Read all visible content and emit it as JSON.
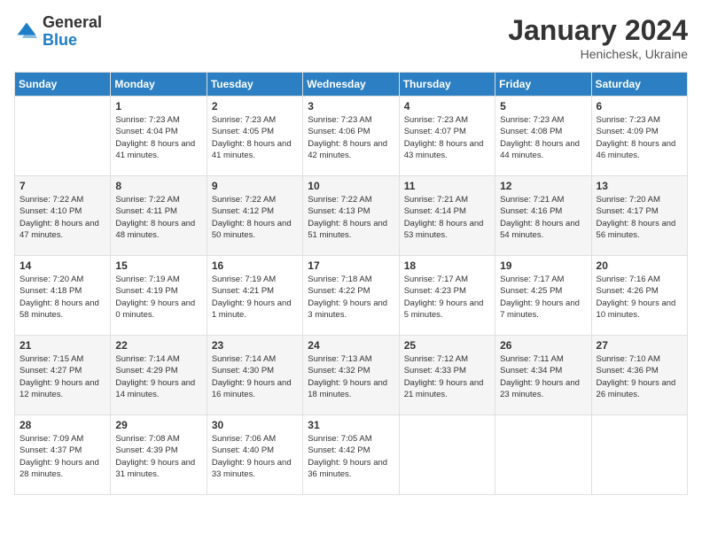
{
  "header": {
    "logo_general": "General",
    "logo_blue": "Blue",
    "month_year": "January 2024",
    "location": "Henichesk, Ukraine"
  },
  "days_of_week": [
    "Sunday",
    "Monday",
    "Tuesday",
    "Wednesday",
    "Thursday",
    "Friday",
    "Saturday"
  ],
  "weeks": [
    [
      {
        "day": "",
        "sunrise": "",
        "sunset": "",
        "daylight": ""
      },
      {
        "day": "1",
        "sunrise": "Sunrise: 7:23 AM",
        "sunset": "Sunset: 4:04 PM",
        "daylight": "Daylight: 8 hours and 41 minutes."
      },
      {
        "day": "2",
        "sunrise": "Sunrise: 7:23 AM",
        "sunset": "Sunset: 4:05 PM",
        "daylight": "Daylight: 8 hours and 41 minutes."
      },
      {
        "day": "3",
        "sunrise": "Sunrise: 7:23 AM",
        "sunset": "Sunset: 4:06 PM",
        "daylight": "Daylight: 8 hours and 42 minutes."
      },
      {
        "day": "4",
        "sunrise": "Sunrise: 7:23 AM",
        "sunset": "Sunset: 4:07 PM",
        "daylight": "Daylight: 8 hours and 43 minutes."
      },
      {
        "day": "5",
        "sunrise": "Sunrise: 7:23 AM",
        "sunset": "Sunset: 4:08 PM",
        "daylight": "Daylight: 8 hours and 44 minutes."
      },
      {
        "day": "6",
        "sunrise": "Sunrise: 7:23 AM",
        "sunset": "Sunset: 4:09 PM",
        "daylight": "Daylight: 8 hours and 46 minutes."
      }
    ],
    [
      {
        "day": "7",
        "sunrise": "Sunrise: 7:22 AM",
        "sunset": "Sunset: 4:10 PM",
        "daylight": "Daylight: 8 hours and 47 minutes."
      },
      {
        "day": "8",
        "sunrise": "Sunrise: 7:22 AM",
        "sunset": "Sunset: 4:11 PM",
        "daylight": "Daylight: 8 hours and 48 minutes."
      },
      {
        "day": "9",
        "sunrise": "Sunrise: 7:22 AM",
        "sunset": "Sunset: 4:12 PM",
        "daylight": "Daylight: 8 hours and 50 minutes."
      },
      {
        "day": "10",
        "sunrise": "Sunrise: 7:22 AM",
        "sunset": "Sunset: 4:13 PM",
        "daylight": "Daylight: 8 hours and 51 minutes."
      },
      {
        "day": "11",
        "sunrise": "Sunrise: 7:21 AM",
        "sunset": "Sunset: 4:14 PM",
        "daylight": "Daylight: 8 hours and 53 minutes."
      },
      {
        "day": "12",
        "sunrise": "Sunrise: 7:21 AM",
        "sunset": "Sunset: 4:16 PM",
        "daylight": "Daylight: 8 hours and 54 minutes."
      },
      {
        "day": "13",
        "sunrise": "Sunrise: 7:20 AM",
        "sunset": "Sunset: 4:17 PM",
        "daylight": "Daylight: 8 hours and 56 minutes."
      }
    ],
    [
      {
        "day": "14",
        "sunrise": "Sunrise: 7:20 AM",
        "sunset": "Sunset: 4:18 PM",
        "daylight": "Daylight: 8 hours and 58 minutes."
      },
      {
        "day": "15",
        "sunrise": "Sunrise: 7:19 AM",
        "sunset": "Sunset: 4:19 PM",
        "daylight": "Daylight: 9 hours and 0 minutes."
      },
      {
        "day": "16",
        "sunrise": "Sunrise: 7:19 AM",
        "sunset": "Sunset: 4:21 PM",
        "daylight": "Daylight: 9 hours and 1 minute."
      },
      {
        "day": "17",
        "sunrise": "Sunrise: 7:18 AM",
        "sunset": "Sunset: 4:22 PM",
        "daylight": "Daylight: 9 hours and 3 minutes."
      },
      {
        "day": "18",
        "sunrise": "Sunrise: 7:17 AM",
        "sunset": "Sunset: 4:23 PM",
        "daylight": "Daylight: 9 hours and 5 minutes."
      },
      {
        "day": "19",
        "sunrise": "Sunrise: 7:17 AM",
        "sunset": "Sunset: 4:25 PM",
        "daylight": "Daylight: 9 hours and 7 minutes."
      },
      {
        "day": "20",
        "sunrise": "Sunrise: 7:16 AM",
        "sunset": "Sunset: 4:26 PM",
        "daylight": "Daylight: 9 hours and 10 minutes."
      }
    ],
    [
      {
        "day": "21",
        "sunrise": "Sunrise: 7:15 AM",
        "sunset": "Sunset: 4:27 PM",
        "daylight": "Daylight: 9 hours and 12 minutes."
      },
      {
        "day": "22",
        "sunrise": "Sunrise: 7:14 AM",
        "sunset": "Sunset: 4:29 PM",
        "daylight": "Daylight: 9 hours and 14 minutes."
      },
      {
        "day": "23",
        "sunrise": "Sunrise: 7:14 AM",
        "sunset": "Sunset: 4:30 PM",
        "daylight": "Daylight: 9 hours and 16 minutes."
      },
      {
        "day": "24",
        "sunrise": "Sunrise: 7:13 AM",
        "sunset": "Sunset: 4:32 PM",
        "daylight": "Daylight: 9 hours and 18 minutes."
      },
      {
        "day": "25",
        "sunrise": "Sunrise: 7:12 AM",
        "sunset": "Sunset: 4:33 PM",
        "daylight": "Daylight: 9 hours and 21 minutes."
      },
      {
        "day": "26",
        "sunrise": "Sunrise: 7:11 AM",
        "sunset": "Sunset: 4:34 PM",
        "daylight": "Daylight: 9 hours and 23 minutes."
      },
      {
        "day": "27",
        "sunrise": "Sunrise: 7:10 AM",
        "sunset": "Sunset: 4:36 PM",
        "daylight": "Daylight: 9 hours and 26 minutes."
      }
    ],
    [
      {
        "day": "28",
        "sunrise": "Sunrise: 7:09 AM",
        "sunset": "Sunset: 4:37 PM",
        "daylight": "Daylight: 9 hours and 28 minutes."
      },
      {
        "day": "29",
        "sunrise": "Sunrise: 7:08 AM",
        "sunset": "Sunset: 4:39 PM",
        "daylight": "Daylight: 9 hours and 31 minutes."
      },
      {
        "day": "30",
        "sunrise": "Sunrise: 7:06 AM",
        "sunset": "Sunset: 4:40 PM",
        "daylight": "Daylight: 9 hours and 33 minutes."
      },
      {
        "day": "31",
        "sunrise": "Sunrise: 7:05 AM",
        "sunset": "Sunset: 4:42 PM",
        "daylight": "Daylight: 9 hours and 36 minutes."
      },
      {
        "day": "",
        "sunrise": "",
        "sunset": "",
        "daylight": ""
      },
      {
        "day": "",
        "sunrise": "",
        "sunset": "",
        "daylight": ""
      },
      {
        "day": "",
        "sunrise": "",
        "sunset": "",
        "daylight": ""
      }
    ]
  ]
}
